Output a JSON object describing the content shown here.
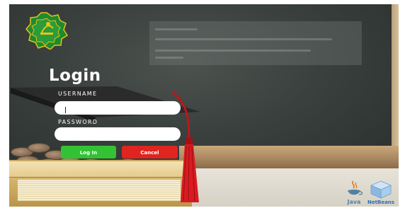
{
  "login": {
    "title": "Login",
    "username_label": "USERNAME",
    "username_value": "",
    "password_label": "PASSWORD",
    "password_value": "",
    "login_button": "Log In",
    "cancel_button": "Cancel"
  },
  "branding": {
    "java_label": "Java",
    "netbeans_label": "NetBeans"
  },
  "colors": {
    "login_button": "#33c234",
    "cancel_button": "#e0241f",
    "chalkboard": "#3a403d",
    "logo_green": "#1f8a2e",
    "logo_gold": "#e8c21a"
  },
  "icons": {
    "logo": "ministry-emblem-icon",
    "java": "java-cup-icon",
    "netbeans": "netbeans-cube-icon"
  }
}
